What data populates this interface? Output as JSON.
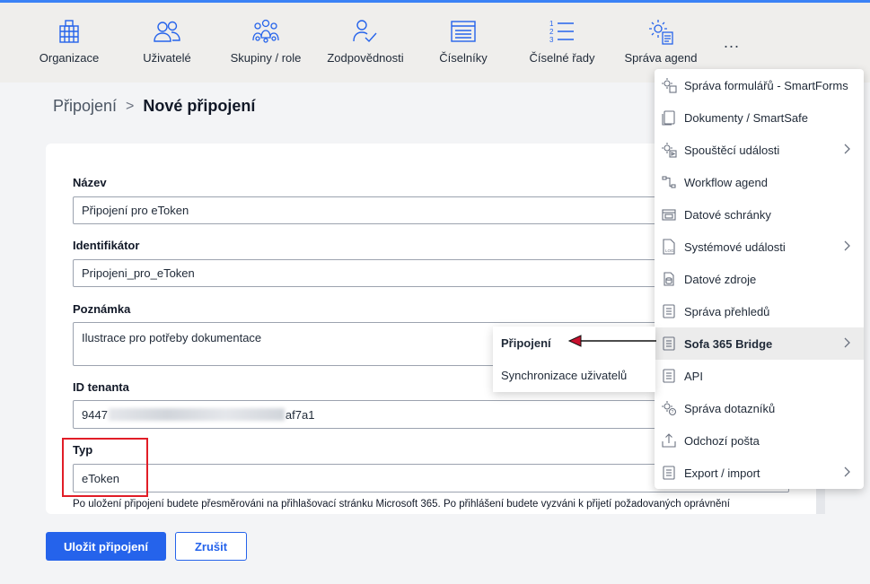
{
  "toolbar": {
    "items": [
      {
        "label": "Organizace",
        "icon": "building-icon"
      },
      {
        "label": "Uživatelé",
        "icon": "users-icon"
      },
      {
        "label": "Skupiny / role",
        "icon": "groups-icon"
      },
      {
        "label": "Zodpovědnosti",
        "icon": "user-check-icon"
      },
      {
        "label": "Číselníky",
        "icon": "list-window-icon"
      },
      {
        "label": "Číselné řady",
        "icon": "numbered-list-icon"
      },
      {
        "label": "Správa agend",
        "icon": "gear-document-icon"
      }
    ],
    "more_label": "..."
  },
  "breadcrumb": {
    "parent": "Připojení",
    "separator": ">",
    "current": "Nové připojení"
  },
  "form": {
    "name_label": "Název",
    "name_value": "Připojení pro eToken",
    "identifier_label": "Identifikátor",
    "identifier_value": "Pripojeni_pro_eToken",
    "note_label": "Poznámka",
    "note_value": "Ilustrace pro potřeby dokumentace",
    "tenant_label": "ID tenanta",
    "tenant_prefix": "9447",
    "tenant_suffix": "af7a1",
    "type_label": "Typ",
    "type_value": "eToken",
    "hint": "Po uložení připojení budete přesměrováni na přihlašovací stránku Microsoft 365. Po přihlášení budete vyzváni k přijetí požadovaných oprávnění"
  },
  "actions": {
    "save": "Uložit připojení",
    "cancel": "Zrušit"
  },
  "dropdown": {
    "items": [
      {
        "label": "Správa formulářů - SmartForms",
        "icon": "gear-form-icon",
        "submenu": false
      },
      {
        "label": "Dokumenty / SmartSafe",
        "icon": "documents-icon",
        "submenu": false
      },
      {
        "label": "Spouštěcí události",
        "icon": "gear-play-icon",
        "submenu": true
      },
      {
        "label": "Workflow agend",
        "icon": "workflow-icon",
        "submenu": false
      },
      {
        "label": "Datové schránky",
        "icon": "mailbox-icon",
        "submenu": false
      },
      {
        "label": "Systémové události",
        "icon": "log-file-icon",
        "submenu": true
      },
      {
        "label": "Datové zdroje",
        "icon": "data-source-icon",
        "submenu": false
      },
      {
        "label": "Správa přehledů",
        "icon": "report-icon",
        "submenu": false
      },
      {
        "label": "Sofa 365 Bridge",
        "icon": "bridge-icon",
        "submenu": true
      },
      {
        "label": "API",
        "icon": "api-icon",
        "submenu": false
      },
      {
        "label": "Správa dotazníků",
        "icon": "questionnaire-icon",
        "submenu": false
      },
      {
        "label": "Odchozí pošta",
        "icon": "outgoing-mail-icon",
        "submenu": false
      },
      {
        "label": "Export / import",
        "icon": "export-import-icon",
        "submenu": true
      }
    ],
    "active": "Sofa 365 Bridge"
  },
  "submenu": {
    "items": [
      "Připojení",
      "Synchronizace uživatelů"
    ]
  },
  "colors": {
    "accent": "#2563eb",
    "highlight_border": "#e11d27",
    "arrow": "#c8102e"
  }
}
